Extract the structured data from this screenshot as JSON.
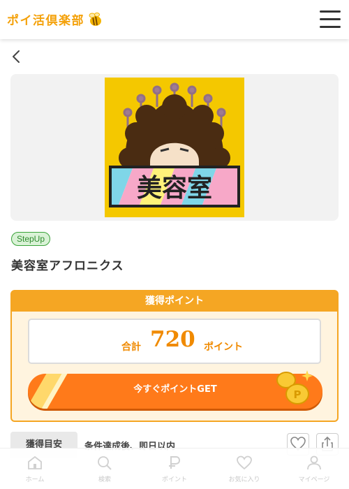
{
  "header": {
    "logo_text": "ポイ活倶楽部",
    "brand_color": "#f4a10a"
  },
  "hero": {
    "image_text": "美容室"
  },
  "offer": {
    "badge": "StepUp",
    "title": "美容室アフロニクス"
  },
  "points": {
    "heading": "獲得ポイント",
    "total_label": "合計",
    "total_value": "720",
    "unit": "ポイント",
    "get_button": "今すぐポイントGET",
    "accent_color": "#f5a623",
    "button_color": "#ff7a1a"
  },
  "guide": {
    "label": "獲得目安",
    "value": "条件達成後、即日以内"
  },
  "tabbar": {
    "items": [
      {
        "label": "ホーム",
        "icon": "home-icon"
      },
      {
        "label": "検索",
        "icon": "search-icon"
      },
      {
        "label": "ポイント",
        "icon": "point-icon"
      },
      {
        "label": "お気に入り",
        "icon": "heart-icon"
      },
      {
        "label": "マイページ",
        "icon": "user-icon"
      }
    ]
  }
}
